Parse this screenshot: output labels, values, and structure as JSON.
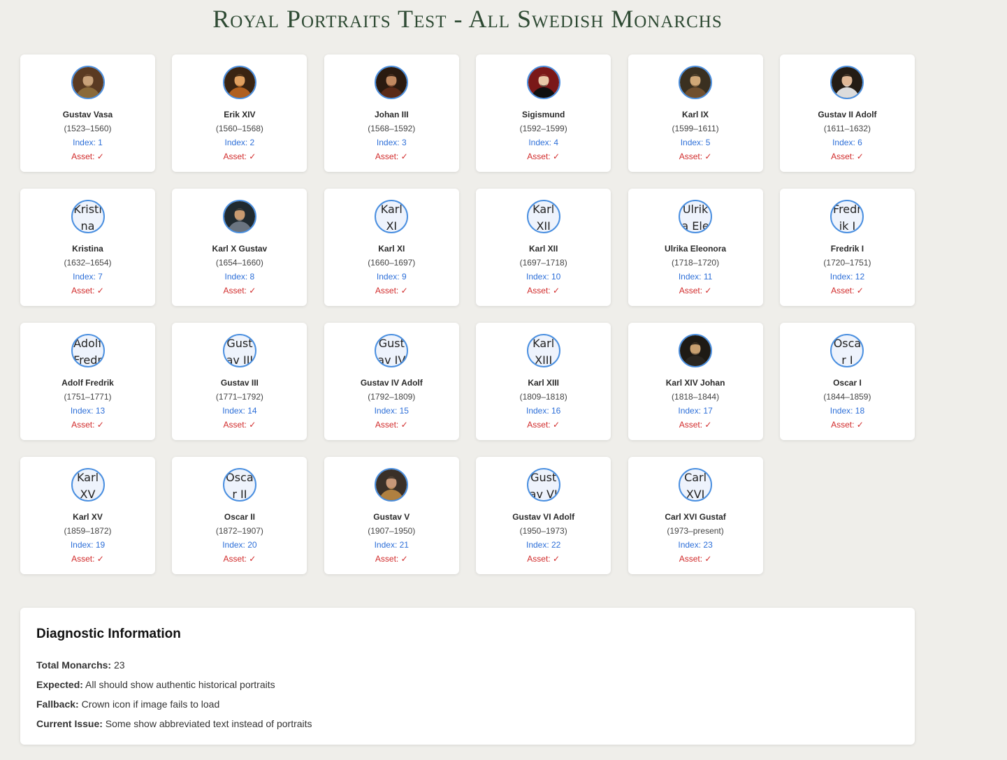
{
  "title": "Royal Portraits Test - All Swedish Monarchs",
  "monarchs": [
    {
      "name": "Gustav Vasa",
      "years": "(1523–1560)",
      "index": "Index: 1",
      "asset": "Asset: ✓",
      "portrait": "image",
      "palette": [
        "#5a3a22",
        "#c9a27a",
        "#8a6a3a"
      ]
    },
    {
      "name": "Erik XIV",
      "years": "(1560–1568)",
      "index": "Index: 2",
      "asset": "Asset: ✓",
      "portrait": "image",
      "palette": [
        "#3a2412",
        "#e0a060",
        "#b06020"
      ]
    },
    {
      "name": "Johan III",
      "years": "(1568–1592)",
      "index": "Index: 3",
      "asset": "Asset: ✓",
      "portrait": "image",
      "palette": [
        "#2a1a10",
        "#c08860",
        "#5a2a18"
      ]
    },
    {
      "name": "Sigismund",
      "years": "(1592–1599)",
      "index": "Index: 4",
      "asset": "Asset: ✓",
      "portrait": "image",
      "palette": [
        "#7a1818",
        "#e8c8a8",
        "#101010"
      ]
    },
    {
      "name": "Karl IX",
      "years": "(1599–1611)",
      "index": "Index: 5",
      "asset": "Asset: ✓",
      "portrait": "image",
      "palette": [
        "#3a3020",
        "#d0a878",
        "#705030"
      ]
    },
    {
      "name": "Gustav II Adolf",
      "years": "(1611–1632)",
      "index": "Index: 6",
      "asset": "Asset: ✓",
      "portrait": "image",
      "palette": [
        "#241c14",
        "#e0b896",
        "#dcdcdc"
      ]
    },
    {
      "name": "Kristina",
      "years": "(1632–1654)",
      "index": "Index: 7",
      "asset": "Asset: ✓",
      "portrait": "text",
      "alt": "Kristina"
    },
    {
      "name": "Karl X Gustav",
      "years": "(1654–1660)",
      "index": "Index: 8",
      "asset": "Asset: ✓",
      "portrait": "image",
      "palette": [
        "#202a30",
        "#c89a70",
        "#6a7480"
      ]
    },
    {
      "name": "Karl XI",
      "years": "(1660–1697)",
      "index": "Index: 9",
      "asset": "Asset: ✓",
      "portrait": "text",
      "alt": "Karl XI"
    },
    {
      "name": "Karl XII",
      "years": "(1697–1718)",
      "index": "Index: 10",
      "asset": "Asset: ✓",
      "portrait": "text",
      "alt": "Karl XII"
    },
    {
      "name": "Ulrika Eleonora",
      "years": "(1718–1720)",
      "index": "Index: 11",
      "asset": "Asset: ✓",
      "portrait": "text",
      "alt": "Ulrika Eleonora"
    },
    {
      "name": "Fredrik I",
      "years": "(1720–1751)",
      "index": "Index: 12",
      "asset": "Asset: ✓",
      "portrait": "text",
      "alt": "Fredrik I"
    },
    {
      "name": "Adolf Fredrik",
      "years": "(1751–1771)",
      "index": "Index: 13",
      "asset": "Asset: ✓",
      "portrait": "text",
      "alt": "Adolf Fredrik"
    },
    {
      "name": "Gustav III",
      "years": "(1771–1792)",
      "index": "Index: 14",
      "asset": "Asset: ✓",
      "portrait": "text",
      "alt": "Gustav III"
    },
    {
      "name": "Gustav IV Adolf",
      "years": "(1792–1809)",
      "index": "Index: 15",
      "asset": "Asset: ✓",
      "portrait": "text",
      "alt": "Gustav IV"
    },
    {
      "name": "Karl XIII",
      "years": "(1809–1818)",
      "index": "Index: 16",
      "asset": "Asset: ✓",
      "portrait": "text",
      "alt": "Karl XIII"
    },
    {
      "name": "Karl XIV Johan",
      "years": "(1818–1844)",
      "index": "Index: 17",
      "asset": "Asset: ✓",
      "portrait": "image",
      "palette": [
        "#1e1a14",
        "#c8a070",
        "#2a2620"
      ]
    },
    {
      "name": "Oscar I",
      "years": "(1844–1859)",
      "index": "Index: 18",
      "asset": "Asset: ✓",
      "portrait": "text",
      "alt": "Oscar I"
    },
    {
      "name": "Karl XV",
      "years": "(1859–1872)",
      "index": "Index: 19",
      "asset": "Asset: ✓",
      "portrait": "text",
      "alt": "Karl XV"
    },
    {
      "name": "Oscar II",
      "years": "(1872–1907)",
      "index": "Index: 20",
      "asset": "Asset: ✓",
      "portrait": "text",
      "alt": "Oscar II"
    },
    {
      "name": "Gustav V",
      "years": "(1907–1950)",
      "index": "Index: 21",
      "asset": "Asset: ✓",
      "portrait": "image",
      "palette": [
        "#3a3028",
        "#c89878",
        "#b08040"
      ]
    },
    {
      "name": "Gustav VI Adolf",
      "years": "(1950–1973)",
      "index": "Index: 22",
      "asset": "Asset: ✓",
      "portrait": "text",
      "alt": "Gustav VI"
    },
    {
      "name": "Carl XVI Gustaf",
      "years": "(1973–present)",
      "index": "Index: 23",
      "asset": "Asset: ✓",
      "portrait": "text",
      "alt": "Carl XVI"
    }
  ],
  "diagnostic": {
    "heading": "Diagnostic Information",
    "total_label": "Total Monarchs:",
    "total_value": " 23",
    "expected_label": "Expected:",
    "expected_value": " All should show authentic historical portraits",
    "fallback_label": "Fallback:",
    "fallback_value": " Crown icon if image fails to load",
    "issue_label": "Current Issue:",
    "issue_value": " Some show abbreviated text instead of portraits"
  }
}
